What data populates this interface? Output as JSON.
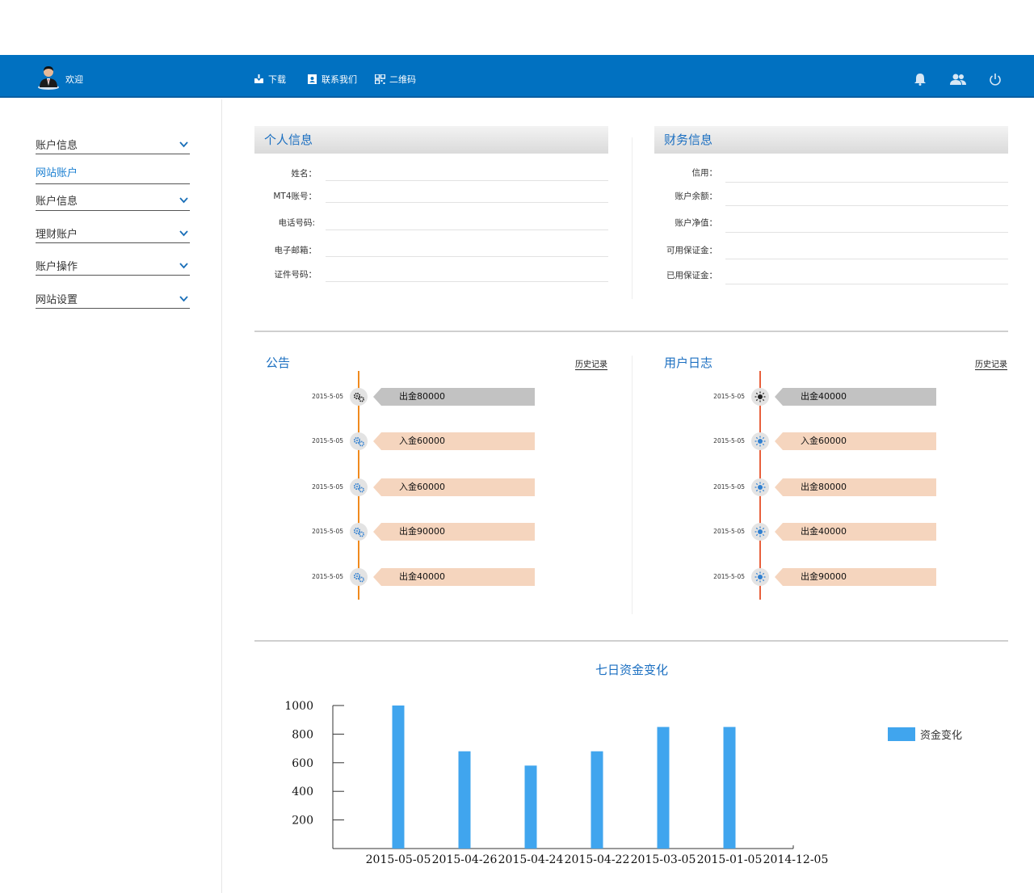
{
  "header": {
    "welcome": "欢迎",
    "nav": [
      {
        "label": "下载",
        "icon": "download-icon"
      },
      {
        "label": "联系我们",
        "icon": "contact-icon"
      },
      {
        "label": "二维码",
        "icon": "qr-code-icon"
      }
    ],
    "right_icons": [
      "bell-icon",
      "users-icon",
      "power-icon"
    ]
  },
  "sidebar": {
    "items": [
      {
        "label": "账户信息",
        "chevron": true,
        "active": false
      },
      {
        "label": "网站账户",
        "chevron": false,
        "active": true
      },
      {
        "label": "账户信息",
        "chevron": true,
        "active": false
      },
      {
        "label": "理财账户",
        "chevron": true,
        "active": false
      },
      {
        "label": "账户操作",
        "chevron": true,
        "active": false
      },
      {
        "label": "网站设置",
        "chevron": true,
        "active": false
      }
    ]
  },
  "personal": {
    "title": "个人信息",
    "fields": [
      {
        "label": "姓名：",
        "value": ""
      },
      {
        "label": "MT4账号：",
        "value": ""
      },
      {
        "label": "电话号码:",
        "value": ""
      },
      {
        "label": "电子邮箱：",
        "value": ""
      },
      {
        "label": "证件号码：",
        "value": ""
      }
    ]
  },
  "finance": {
    "title": "财务信息",
    "fields": [
      {
        "label": "信用：",
        "value": ""
      },
      {
        "label": "账户余额：",
        "value": ""
      },
      {
        "label": "账户净值：",
        "value": ""
      },
      {
        "label": "可用保证金：",
        "value": ""
      },
      {
        "label": "已用保证金：",
        "value": ""
      }
    ]
  },
  "announcements": {
    "title": "公告",
    "history": "历史记录",
    "items": [
      {
        "date": "2015-5-05",
        "text": "出金80000",
        "highlight": true
      },
      {
        "date": "2015-5-05",
        "text": "入金60000",
        "highlight": false
      },
      {
        "date": "2015-5-05",
        "text": "入金60000",
        "highlight": false
      },
      {
        "date": "2015-5-05",
        "text": "出金90000",
        "highlight": false
      },
      {
        "date": "2015-5-05",
        "text": "出金40000",
        "highlight": false
      }
    ]
  },
  "user_log": {
    "title": "用户日志",
    "history": "历史记录",
    "items": [
      {
        "date": "2015-5-05",
        "text": "出金40000",
        "highlight": true
      },
      {
        "date": "2015-5-05",
        "text": "入金60000",
        "highlight": false
      },
      {
        "date": "2015-5-05",
        "text": "出金80000",
        "highlight": false
      },
      {
        "date": "2015-5-05",
        "text": "出金40000",
        "highlight": false
      },
      {
        "date": "2015-5-05",
        "text": "出金90000",
        "highlight": false
      }
    ]
  },
  "colors": {
    "brand": "#0171c1",
    "accent_text": "#1b6fc1",
    "tag_highlight": "#c2c2c2",
    "tag_normal": "#f5d5be",
    "timeline_left": "#f08a1e",
    "timeline_right": "#e8603c",
    "bar": "#40a5ee"
  },
  "chart_data": {
    "type": "bar",
    "title": "七日资金变化",
    "categories": [
      "2015-05-05",
      "2015-04-26",
      "2015-04-24",
      "2015-04-22",
      "2015-03-05",
      "2015-01-05",
      "2014-12-05"
    ],
    "series": [
      {
        "name": "资金变化",
        "values": [
          1000,
          680,
          580,
          680,
          850,
          850,
          null
        ]
      }
    ],
    "yticks": [
      200,
      400,
      600,
      800,
      1000
    ],
    "ylim": [
      0,
      1000
    ],
    "legend": "right",
    "grid": false
  }
}
